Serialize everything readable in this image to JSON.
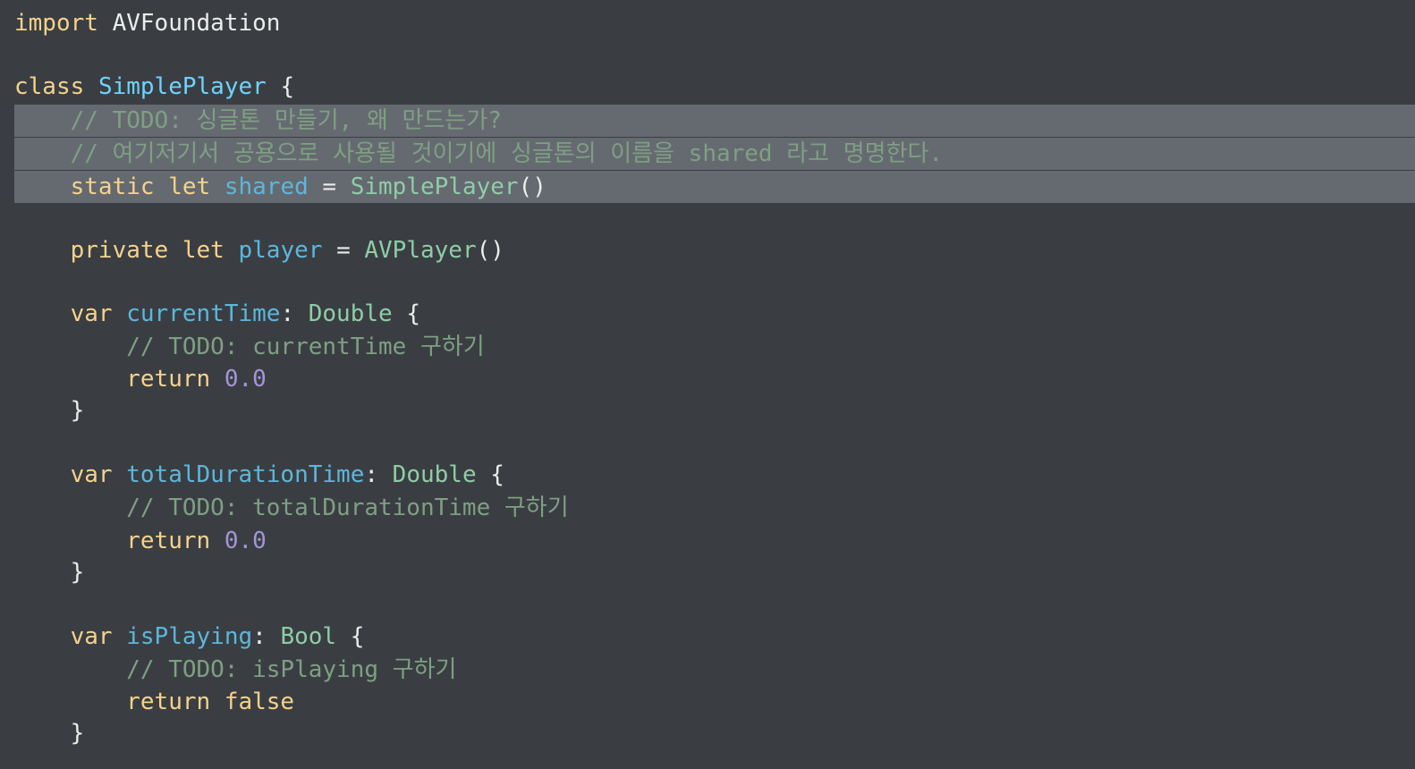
{
  "code": {
    "line1": {
      "kw": "import",
      "name": "AVFoundation"
    },
    "line3": {
      "kw": "class",
      "name": "SimplePlayer",
      "brace": "{"
    },
    "line4": {
      "comment": "// TODO: 싱글톤 만들기, 왜 만드는가?"
    },
    "line5": {
      "comment": "// 여기저기서 공용으로 사용될 것이기에 싱글톤의 이름을 shared 라고 명명한다."
    },
    "line6": {
      "kw1": "static",
      "kw2": "let",
      "name": "shared",
      "eq": "=",
      "value": "SimplePlayer",
      "paren": "()"
    },
    "line8": {
      "kw1": "private",
      "kw2": "let",
      "name": "player",
      "eq": "=",
      "value": "AVPlayer",
      "paren": "()"
    },
    "line10": {
      "kw": "var",
      "name": "currentTime",
      "colon": ":",
      "type": "Double",
      "brace": "{"
    },
    "line11": {
      "comment": "// TODO: currentTime 구하기"
    },
    "line12": {
      "kw": "return",
      "value": "0.0"
    },
    "line13": {
      "brace": "}"
    },
    "line15": {
      "kw": "var",
      "name": "totalDurationTime",
      "colon": ":",
      "type": "Double",
      "brace": "{"
    },
    "line16": {
      "comment": "// TODO: totalDurationTime 구하기"
    },
    "line17": {
      "kw": "return",
      "value": "0.0"
    },
    "line18": {
      "brace": "}"
    },
    "line20": {
      "kw": "var",
      "name": "isPlaying",
      "colon": ":",
      "type": "Bool",
      "brace": "{"
    },
    "line21": {
      "comment": "// TODO: isPlaying 구하기"
    },
    "line22": {
      "kw": "return",
      "value": "false"
    },
    "line23": {
      "brace": "}"
    }
  },
  "colors": {
    "background": "#3a3e42",
    "selection": "#656a70",
    "keyword": "#f5d28c",
    "type_declaration": "#6ed3ff",
    "identifier": "#5cb7dc",
    "class_name": "#8fcda7",
    "comment": "#7f9f84",
    "number": "#a495d8",
    "plain": "#ececec"
  }
}
